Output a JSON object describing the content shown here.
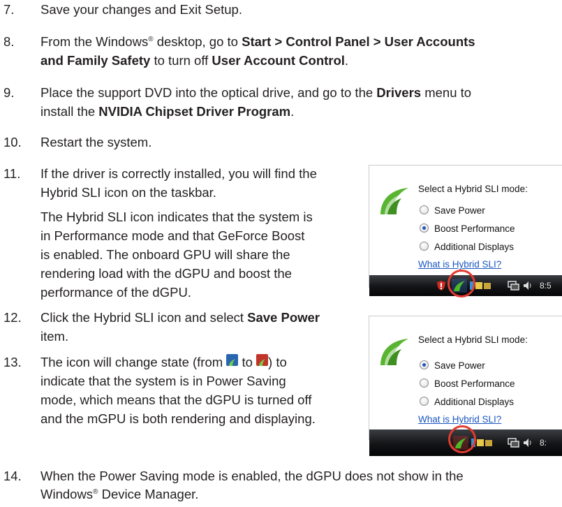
{
  "steps": [
    {
      "num": "7.",
      "line1": "Save your changes and Exit Setup."
    },
    {
      "num": "8.",
      "l1_a": "From the Windows",
      "l1_sup": "®",
      "l1_b": " desktop, go to ",
      "l1_bold": "Start > Control Panel > User Accounts",
      "l2_bold1": "and Family Safety",
      "l2_mid": " to turn off ",
      "l2_bold2": "User Account Control",
      "l2_end": "."
    },
    {
      "num": "9.",
      "l1_a": "Place the support DVD into the optical drive, and go to the ",
      "l1_bold": "Drivers",
      "l1_b": " menu to",
      "l2_a": "install the ",
      "l2_bold": "NVIDIA Chipset Driver Program",
      "l2_end": "."
    },
    {
      "num": "10.",
      "line1": "Restart the system."
    },
    {
      "num": "11.",
      "line1": "If the driver is correctly installed, you will find the",
      "line2": "Hybrid SLI icon on the taskbar."
    },
    {
      "num": "12.",
      "l1_a": "Click the Hybrid SLI icon and select ",
      "l1_bold": "Save Power",
      "line2": "item."
    },
    {
      "num": "13.",
      "l1_a": "The icon will change state (from ",
      "l1_b": " to ",
      "l1_c": ") to",
      "line2": "indicate that the system is in Power Saving",
      "line3": "mode, which means that the dGPU is turned off",
      "line4": "and the mGPU is both rendering and displaying."
    },
    {
      "num": "14.",
      "line1": "When the Power Saving mode is enabled, the dGPU does not show in the",
      "l2_a": "Windows",
      "l2_sup": "®",
      "l2_b": " Device Manager."
    }
  ],
  "step11_para": [
    "The Hybrid SLI icon indicates that the system is",
    "in Performance mode and that GeForce Boost",
    "is enabled. The onboard GPU will share the",
    "rendering load with the dGPU and boost the",
    "performance of the dGPU."
  ],
  "panels": [
    {
      "heading": "Select a Hybrid SLI mode:",
      "options": [
        "Save Power",
        "Boost Performance",
        "Additional Displays"
      ],
      "selected": "Boost Performance",
      "link": "What is Hybrid SLI?",
      "clock": "8:5"
    },
    {
      "heading": "Select a Hybrid SLI mode:",
      "options": [
        "Save Power",
        "Boost Performance",
        "Additional Displays"
      ],
      "selected": "Save Power",
      "link": "What is Hybrid SLI?",
      "clock": "8:"
    }
  ],
  "colors": {
    "nvidia_green": "#4aa52e",
    "highlight_ring": "#e33a2f",
    "link": "#1a57c0",
    "text": "#231f20"
  },
  "icons": {
    "hybrid_sli_boost": "nvidia-eye-icon-blue",
    "hybrid_sli_power": "nvidia-eye-icon-red"
  }
}
